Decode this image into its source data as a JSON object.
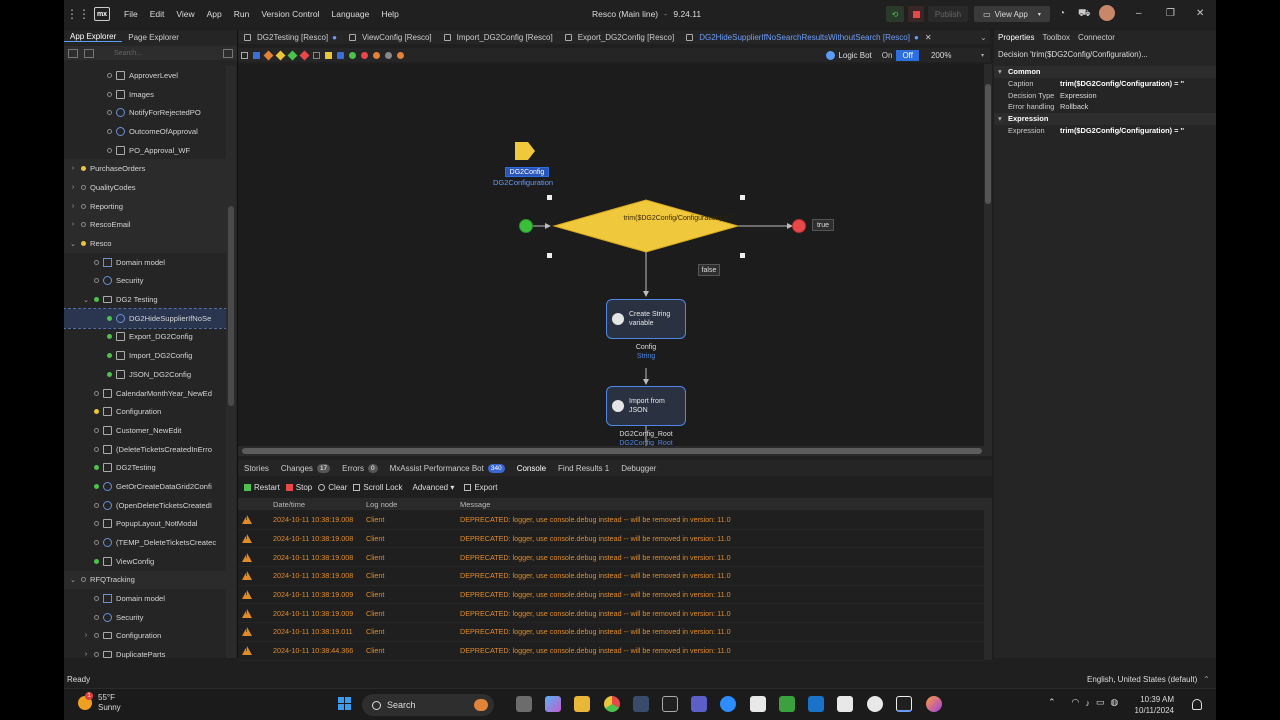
{
  "titlebar": {
    "menus": [
      "File",
      "Edit",
      "View",
      "App",
      "Run",
      "Version Control",
      "Language",
      "Help"
    ],
    "title": "Resco (Main line)",
    "version": "9.24.11",
    "publish_label": "Publish",
    "view_app_label": "View App"
  },
  "left_panel": {
    "tabs": [
      "App Explorer",
      "Page Explorer"
    ],
    "search_placeholder": "Search...",
    "items": [
      {
        "label": "ApproverLevel",
        "indent": 2,
        "dot": "e",
        "icon": "sq"
      },
      {
        "label": "Images",
        "indent": 2,
        "dot": "e",
        "icon": "sq"
      },
      {
        "label": "NotifyForRejectedPO",
        "indent": 2,
        "dot": "e",
        "icon": "circle"
      },
      {
        "label": "OutcomeOfApproval",
        "indent": 2,
        "dot": "e",
        "icon": "circle"
      },
      {
        "label": "PO_Approval_WF",
        "indent": 2,
        "dot": "e",
        "icon": "sq"
      },
      {
        "label": "PurchaseOrders",
        "indent": 0,
        "dot": "y",
        "icon": "none",
        "chev": "›"
      },
      {
        "label": "QualityCodes",
        "indent": 0,
        "dot": "e",
        "icon": "none",
        "chev": "›"
      },
      {
        "label": "Reporting",
        "indent": 0,
        "dot": "e",
        "icon": "none",
        "chev": "›"
      },
      {
        "label": "RescoEmail",
        "indent": 0,
        "dot": "e",
        "icon": "none",
        "chev": "›"
      },
      {
        "label": "Resco",
        "indent": 0,
        "dot": "y",
        "icon": "none",
        "chev": "⌄"
      },
      {
        "label": "Domain model",
        "indent": 1,
        "dot": "e",
        "icon": "mod"
      },
      {
        "label": "Security",
        "indent": 1,
        "dot": "e",
        "icon": "circle"
      },
      {
        "label": "DG2 Testing",
        "indent": 1,
        "dot": "g",
        "icon": "fold",
        "chev": "⌄"
      },
      {
        "label": "DG2HideSupplierIfNoSe",
        "indent": 2,
        "dot": "g",
        "icon": "circle",
        "selected": true
      },
      {
        "label": "Export_DG2Config",
        "indent": 2,
        "dot": "g",
        "icon": "sq"
      },
      {
        "label": "Import_DG2Config",
        "indent": 2,
        "dot": "g",
        "icon": "sq"
      },
      {
        "label": "JSON_DG2Config",
        "indent": 2,
        "dot": "g",
        "icon": "sq"
      },
      {
        "label": "CalendarMonthYear_NewEd",
        "indent": 1,
        "dot": "e",
        "icon": "sq"
      },
      {
        "label": "Configuration",
        "indent": 1,
        "dot": "y",
        "icon": "sq"
      },
      {
        "label": "Customer_NewEdit",
        "indent": 1,
        "dot": "e",
        "icon": "sq"
      },
      {
        "label": "(DeleteTicketsCreatedInErro",
        "indent": 1,
        "dot": "e",
        "icon": "sq"
      },
      {
        "label": "DG2Testing",
        "indent": 1,
        "dot": "g",
        "icon": "sq"
      },
      {
        "label": "GetOrCreateDataGrid2Confi",
        "indent": 1,
        "dot": "g",
        "icon": "circle"
      },
      {
        "label": "(OpenDeleteTicketsCreatedI",
        "indent": 1,
        "dot": "e",
        "icon": "circle"
      },
      {
        "label": "PopupLayout_NotModal",
        "indent": 1,
        "dot": "e",
        "icon": "sq"
      },
      {
        "label": "(TEMP_DeleteTicketsCreatec",
        "indent": 1,
        "dot": "e",
        "icon": "circle"
      },
      {
        "label": "ViewConfig",
        "indent": 1,
        "dot": "g",
        "icon": "sq"
      },
      {
        "label": "RFQTracking",
        "indent": 0,
        "dot": "e",
        "icon": "none",
        "chev": "⌄"
      },
      {
        "label": "Domain model",
        "indent": 1,
        "dot": "e",
        "icon": "mod"
      },
      {
        "label": "Security",
        "indent": 1,
        "dot": "e",
        "icon": "circle"
      },
      {
        "label": "Configuration",
        "indent": 1,
        "dot": "e",
        "icon": "fold",
        "chev": "›"
      },
      {
        "label": "DuplicateParts",
        "indent": 1,
        "dot": "e",
        "icon": "fold",
        "chev": "›"
      }
    ]
  },
  "editor_tabs": [
    {
      "label": "DG2Testing [Resco]",
      "modified": true
    },
    {
      "label": "ViewConfig [Resco]"
    },
    {
      "label": "Import_DG2Config [Resco]"
    },
    {
      "label": "Export_DG2Config [Resco]"
    },
    {
      "label": "DG2HideSupplierIfNoSearchResultsWithoutSearch [Resco]",
      "active": true,
      "modified": true
    }
  ],
  "canvas": {
    "logic_bot": "Logic Bot",
    "toggle_on": "On",
    "toggle_off": "Off",
    "zoom": "200%",
    "parameter_tag": "DG2Config",
    "parameter_name": "DG2Configuration",
    "decision_expr": "trim($DG2Config/Configuration) = ''",
    "true_label": "true",
    "false_label": "false",
    "activity1": {
      "text": "Create String variable",
      "out_name": "Config",
      "out_type": "String"
    },
    "activity2": {
      "text": "Import from JSON",
      "out_name": "DG2Config_Root",
      "out_type": "DG2Config_Root"
    }
  },
  "bottom_panel": {
    "tabs": [
      {
        "label": "Stories"
      },
      {
        "label": "Changes",
        "badge": "17"
      },
      {
        "label": "Errors",
        "badge": "0"
      },
      {
        "label": "MxAssist Performance Bot",
        "badge": "340",
        "blue": true
      },
      {
        "label": "Console",
        "active": true
      },
      {
        "label": "Find Results 1"
      },
      {
        "label": "Debugger"
      }
    ],
    "toolbar": [
      "Restart",
      "Stop",
      "Clear",
      "Scroll Lock",
      "Advanced ▾",
      "Export"
    ],
    "columns": [
      "Date/time",
      "Log node",
      "Message"
    ],
    "rows": [
      {
        "time": "2024-10-11 10:38:19.008",
        "node": "Client",
        "message": "DEPRECATED: logger, use console.debug instead -- will be removed in version: 11.0"
      },
      {
        "time": "2024-10-11 10:38:19.008",
        "node": "Client",
        "message": "DEPRECATED: logger, use console.debug instead -- will be removed in version: 11.0"
      },
      {
        "time": "2024-10-11 10:38:19.008",
        "node": "Client",
        "message": "DEPRECATED: logger, use console.debug instead -- will be removed in version: 11.0"
      },
      {
        "time": "2024-10-11 10:38:19.008",
        "node": "Client",
        "message": "DEPRECATED: logger, use console.debug instead -- will be removed in version: 11.0"
      },
      {
        "time": "2024-10-11 10:38:19.009",
        "node": "Client",
        "message": "DEPRECATED: logger, use console.debug instead -- will be removed in version: 11.0"
      },
      {
        "time": "2024-10-11 10:38:19.009",
        "node": "Client",
        "message": "DEPRECATED: logger, use console.debug instead -- will be removed in version: 11.0"
      },
      {
        "time": "2024-10-11 10:38:19.011",
        "node": "Client",
        "message": "DEPRECATED: logger, use console.debug instead -- will be removed in version: 11.0"
      },
      {
        "time": "2024-10-11 10:38:44.366",
        "node": "Client",
        "message": "DEPRECATED: logger, use console.debug instead -- will be removed in version: 11.0"
      }
    ]
  },
  "right_panel": {
    "tabs": [
      "Properties",
      "Toolbox",
      "Connector"
    ],
    "title": "Decision 'trim($DG2Config/Configuration)...",
    "sections": {
      "common": "Common",
      "expression": "Expression"
    },
    "props": {
      "caption_label": "Caption",
      "caption_value": "trim($DG2Config/Configuration) = ''",
      "decision_type_label": "Decision Type",
      "decision_type_value": "Expression",
      "error_handling_label": "Error handling",
      "error_handling_value": "Rollback",
      "expression_label": "Expression",
      "expression_value": "trim($DG2Config/Configuration) = ''"
    }
  },
  "status": {
    "ready": "Ready",
    "language": "English, United States (default)"
  },
  "taskbar": {
    "temp": "55°F",
    "condition": "Sunny",
    "weather_badge": "1",
    "search": "Search",
    "time": "10:39 AM",
    "date": "10/11/2024"
  },
  "colors": {
    "accent": "#2d6fe0",
    "decision": "#f0c83c",
    "start": "#3bbf3b",
    "end": "#e84848",
    "warn": "#e08b2a"
  }
}
